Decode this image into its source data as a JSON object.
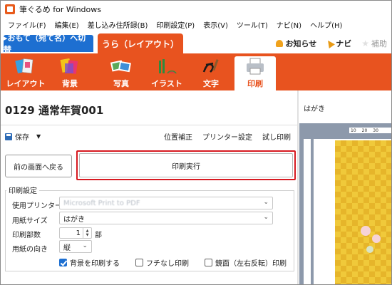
{
  "window": {
    "title": "筆ぐるめ for Windows"
  },
  "menu": [
    "ファイル(F)",
    "編集(E)",
    "差し込み住所録(B)",
    "印刷設定(P)",
    "表示(V)",
    "ツール(T)",
    "ナビ(N)",
    "ヘルプ(H)"
  ],
  "tabs": {
    "front_label": "▸おもて（宛て名）へ切替",
    "back_label": "うら（レイアウト）"
  },
  "top_links": {
    "notice": "お知らせ",
    "navi": "ナビ",
    "help": "補助"
  },
  "toolbar": {
    "items": [
      {
        "label": "レイアウト",
        "icon": "layout-icon"
      },
      {
        "label": "背景",
        "icon": "background-icon"
      },
      {
        "label": "写真",
        "icon": "photo-icon"
      },
      {
        "label": "イラスト",
        "icon": "illustration-icon"
      },
      {
        "label": "文字",
        "icon": "text-icon"
      },
      {
        "label": "印刷",
        "icon": "printer-icon"
      }
    ],
    "active_index": 5
  },
  "document": {
    "title": "0129 通常年賀001"
  },
  "actions": {
    "save_label": "保存",
    "position_label": "位置補正",
    "printer_settings_label": "プリンター設定",
    "test_print_label": "試し印刷",
    "back_label": "前の画面へ戻る",
    "print_label": "印刷実行"
  },
  "print_settings": {
    "section_title": "印刷設定",
    "printer_label": "使用プリンター",
    "printer_value": "Microsoft Print to PDF",
    "paper_label": "用紙サイズ",
    "paper_value": "はがき",
    "copies_label": "印刷部数",
    "copies_value": "1",
    "copies_unit": "部",
    "orientation_label": "用紙の向き",
    "orientation_value": "縦",
    "check_background": {
      "label": "背景を印刷する",
      "checked": true
    },
    "check_borderless": {
      "label": "フチなし印刷",
      "checked": false
    },
    "check_mirror": {
      "label": "鏡面（左右反転）印刷",
      "checked": false
    }
  },
  "preview": {
    "label": "はがき",
    "ruler_top": [
      "10",
      "20",
      "30"
    ]
  },
  "colors": {
    "accent_orange": "#e8531f",
    "accent_blue": "#1d6fd1",
    "highlight_red": "#d71920"
  }
}
